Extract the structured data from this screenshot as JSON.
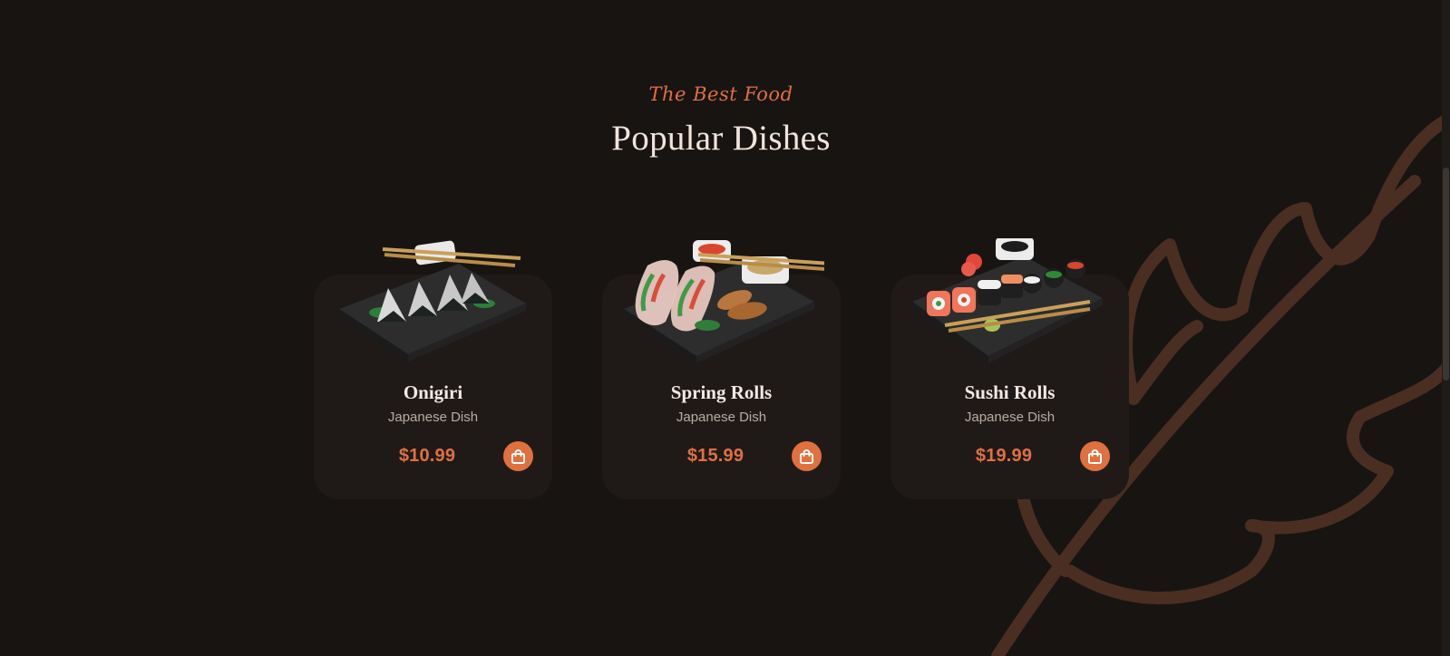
{
  "section": {
    "subtitle": "The Best Food",
    "title": "Popular Dishes"
  },
  "dishes": [
    {
      "name": "Onigiri",
      "type": "Japanese Dish",
      "price": "$10.99",
      "image_icon": "onigiri-plate-image"
    },
    {
      "name": "Spring Rolls",
      "type": "Japanese Dish",
      "price": "$15.99",
      "image_icon": "spring-rolls-plate-image"
    },
    {
      "name": "Sushi Rolls",
      "type": "Japanese Dish",
      "price": "$19.99",
      "image_icon": "sushi-rolls-plate-image"
    }
  ],
  "colors": {
    "background": "#181412",
    "card": "#1f1a18",
    "accent": "#e0703e",
    "title": "#f0e4dc",
    "muted": "#b8aca5",
    "leaf": "#4a2e22"
  },
  "icons": {
    "cart": "shopping-bag-icon",
    "decoration": "leaf-outline-icon"
  }
}
